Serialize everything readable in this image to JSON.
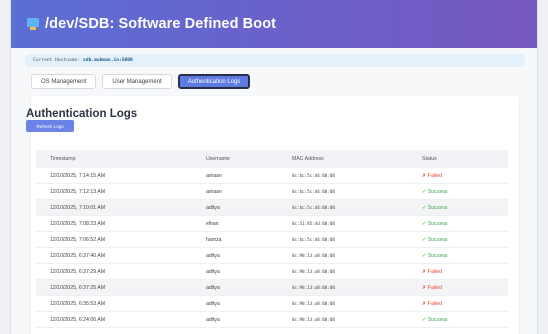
{
  "header": {
    "title": "/dev/SDB: Software Defined Boot"
  },
  "hostname_bar": {
    "label": "Current Hostname:",
    "value": "sdb.mukman.in:5000"
  },
  "tabs": [
    {
      "label": "OS Management"
    },
    {
      "label": "User Management"
    },
    {
      "label": "Authentication Logs"
    }
  ],
  "main": {
    "title": "Authentication Logs",
    "refresh_label": "Refresh Logs"
  },
  "table": {
    "columns": [
      "Timestamp",
      "Username",
      "MAC Address",
      "Status"
    ],
    "rows": [
      {
        "timestamp": "12/10/2025, 7:14:15 AM",
        "username": "amaan",
        "mac": "0c:bc:5c:d4:00:00",
        "status": "✗ Failed"
      },
      {
        "timestamp": "12/10/2025, 7:12:13 AM",
        "username": "amaan",
        "mac": "0c:bc:5c:d4:00:00",
        "status": "✓ Success"
      },
      {
        "timestamp": "12/10/2025, 7:10:01 AM",
        "username": "aditya",
        "mac": "0c:bc:5c:d4:00:00",
        "status": "✓ Success"
      },
      {
        "timestamp": "12/10/2025, 7:08:23 AM",
        "username": "elhan",
        "mac": "0c:51:85:4d:00:00",
        "status": "✓ Success"
      },
      {
        "timestamp": "12/10/2025, 7:06:52 AM",
        "username": "hamza",
        "mac": "0c:bc:5c:d4:00:00",
        "status": "✓ Success"
      },
      {
        "timestamp": "12/10/2025, 6:37:40 AM",
        "username": "aditya",
        "mac": "0c:98:13:a8:00:00",
        "status": "✓ Success"
      },
      {
        "timestamp": "12/10/2025, 6:37:29 AM",
        "username": "aditya",
        "mac": "0c:98:13:a8:00:00",
        "status": "✗ Failed"
      },
      {
        "timestamp": "12/10/2025, 6:37:25 AM",
        "username": "aditya",
        "mac": "0c:98:13:a8:00:00",
        "status": "✗ Failed"
      },
      {
        "timestamp": "12/10/2025, 6:35:53 AM",
        "username": "aditya",
        "mac": "0c:98:13:a8:00:00",
        "status": "✗ Failed"
      },
      {
        "timestamp": "12/10/2025, 6:24:06 AM",
        "username": "aditya",
        "mac": "0c:98:13:a8:00:00",
        "status": "✓ Success"
      }
    ]
  },
  "colors": {
    "header_gradient_start": "#5b6fd6",
    "header_gradient_end": "#7658c0",
    "accent": "#5c7adf",
    "failed": "#e0463a",
    "success": "#3aa24a"
  },
  "icons": {
    "app": "computer-monitor-icon"
  }
}
